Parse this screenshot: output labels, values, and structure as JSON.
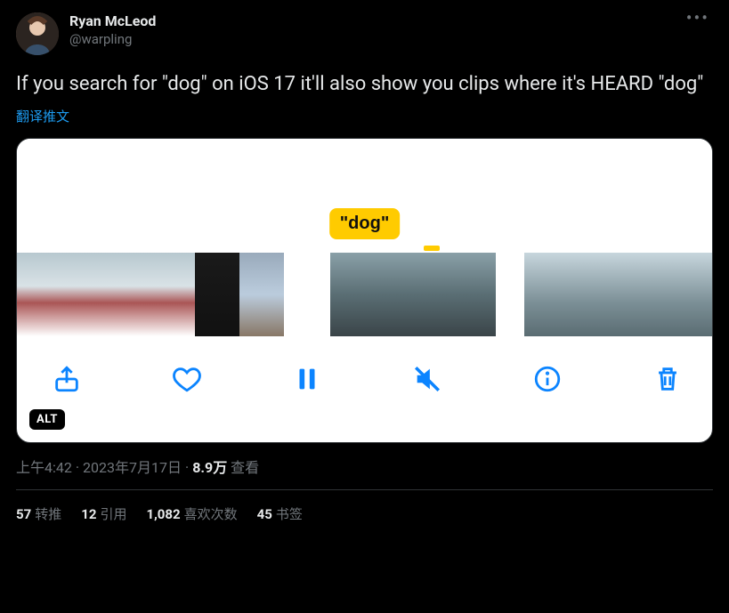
{
  "author": {
    "display_name": "Ryan McLeod",
    "handle": "@warpling"
  },
  "tweet_text": "If you search for \"dog\" on iOS 17 it'll also show you clips where it's HEARD \"dog\"",
  "translate_label": "翻译推文",
  "media": {
    "tag_label": "\"dog\"",
    "alt_badge": "ALT"
  },
  "timestamp": {
    "time": "上午4:42",
    "date": "2023年7月17日",
    "views_value": "8.9万",
    "views_label": "查看"
  },
  "stats": {
    "retweets": {
      "count": "57",
      "label": "转推"
    },
    "quotes": {
      "count": "12",
      "label": "引用"
    },
    "likes": {
      "count": "1,082",
      "label": "喜欢次数"
    },
    "bookmarks": {
      "count": "45",
      "label": "书签"
    }
  }
}
